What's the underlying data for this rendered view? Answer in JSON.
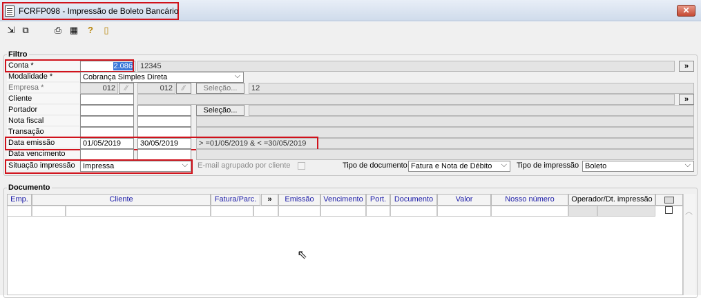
{
  "window": {
    "title": "FCRFP098 - Impressão de Boleto Bancário",
    "close_glyph": "✕"
  },
  "toolbar": {
    "icons": [
      "first-record-icon",
      "last-record-icon",
      "print-icon",
      "calendar-icon",
      "help-icon",
      "exit-door-icon"
    ]
  },
  "filtro": {
    "legend": "Filtro",
    "conta": {
      "label": "Conta *",
      "value": "2.086",
      "desc": "12345",
      "btn": "»"
    },
    "modalidade": {
      "label": "Modalidade *",
      "value": "Cobrança Simples Direta"
    },
    "empresa": {
      "label": "Empresa *",
      "from": "012",
      "to": "012",
      "selecao": "Seleção...",
      "desc": "12"
    },
    "cliente": {
      "label": "Cliente",
      "btn": "»"
    },
    "portador": {
      "label": "Portador",
      "selecao": "Seleção..."
    },
    "nota_fiscal": {
      "label": "Nota fiscal"
    },
    "transacao": {
      "label": "Transação"
    },
    "data_emissao": {
      "label": "Data emissão",
      "from": "01/05/2019",
      "to": "30/05/2019",
      "expr": "> =01/05/2019 & < =30/05/2019"
    },
    "data_vencimento": {
      "label": "Data vencimento"
    },
    "situacao": {
      "label": "Situação impressão",
      "value": "Impressa"
    },
    "email_agrupado": {
      "label": "E-mail agrupado por cliente"
    },
    "tipo_documento": {
      "label": "Tipo de documento",
      "value": "Fatura e Nota de Débito"
    },
    "tipo_impressao": {
      "label": "Tipo de impressão",
      "value": "Boleto"
    }
  },
  "documento": {
    "legend": "Documento",
    "columns": [
      "Emp.",
      "Cliente",
      "Fatura/Parc.",
      "»",
      "Emissão",
      "Vencimento",
      "Port.",
      "Documento",
      "Valor",
      "Nosso número",
      "Operador/Dt. impressão"
    ]
  },
  "colors": {
    "highlight_border": "#d0121b",
    "selection": "#3b78d8",
    "header_text": "#1a1aa6"
  }
}
